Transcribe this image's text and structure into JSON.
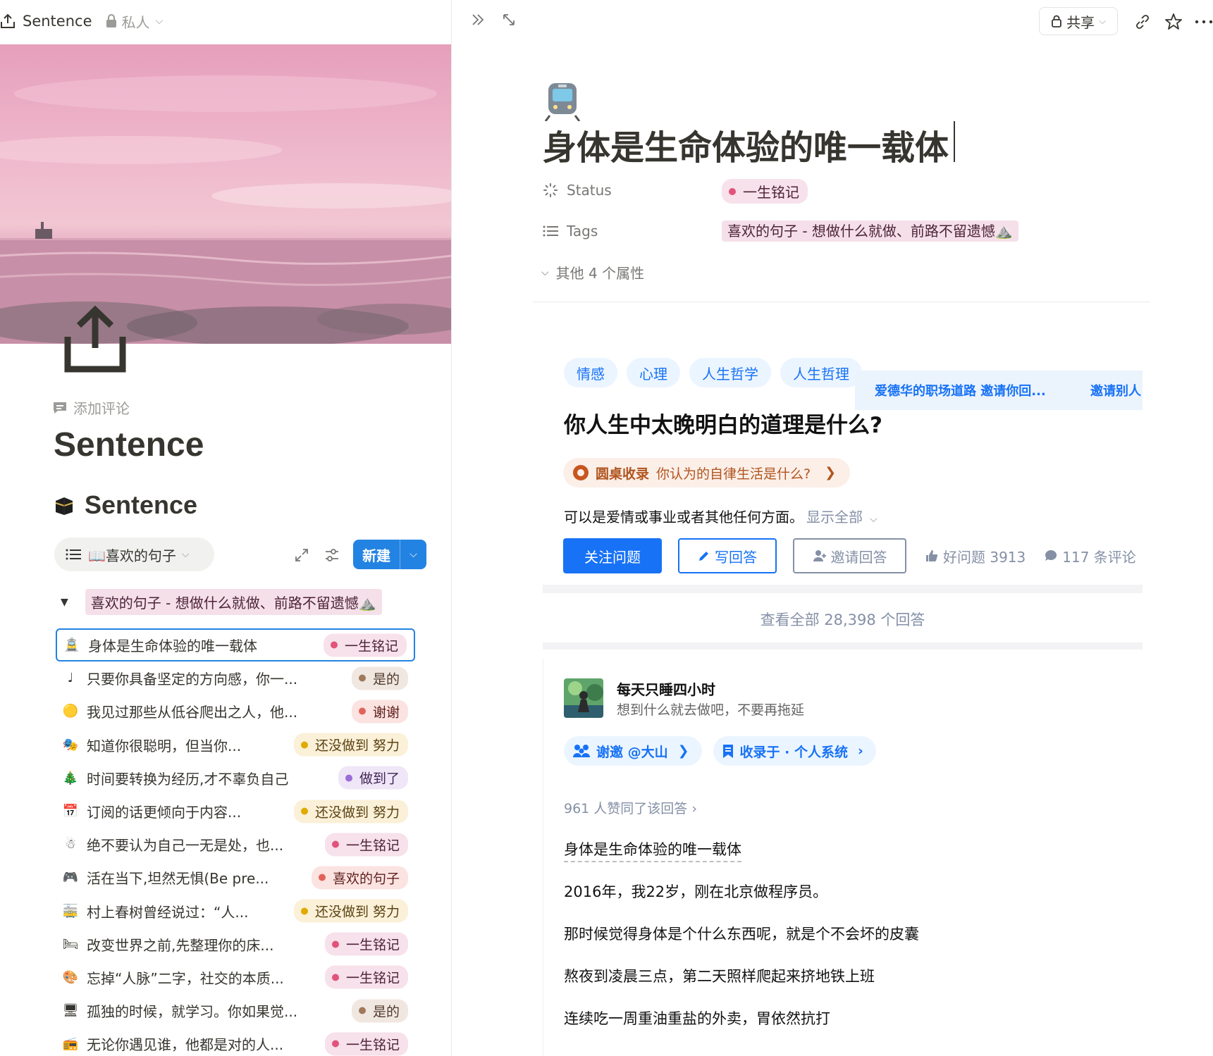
{
  "left": {
    "breadcrumb_title": "Sentence",
    "privacy": "私人",
    "add_comment": "添加评论",
    "page_title": "Sentence",
    "database_title": "Sentence",
    "view_name": "📖喜欢的句子",
    "new_button": "新建",
    "group_label": "喜欢的句子 - 想做什么就做、前路不留遗憾⛰️",
    "rows": [
      {
        "icon": "train-icon",
        "glyph": "🚊",
        "title": "身体是生命体验的唯一载体",
        "status": "一生铭记",
        "bg": "#f7e1ea",
        "fg": "#4c2337",
        "dot": "#e2527a"
      },
      {
        "icon": "music-note-icon",
        "glyph": "♩",
        "title": "只要你具备坚定的方向感，你一...",
        "status": "是的",
        "bg": "#f1e7e1",
        "fg": "#4f3a2c",
        "dot": "#a0785a"
      },
      {
        "icon": "coin-icon",
        "glyph": "🟡",
        "title": "我见过那些从低谷爬出之人，他...",
        "status": "谢谢",
        "bg": "#fbe3e1",
        "fg": "#5e1e1a",
        "dot": "#e16259"
      },
      {
        "icon": "masks-icon",
        "glyph": "🎭",
        "title": "知道你很聪明，但当你...",
        "status": "还没做到 努力",
        "bg": "#fbf0d8",
        "fg": "#5a4312",
        "dot": "#dfab01"
      },
      {
        "icon": "tree-icon",
        "glyph": "🎄",
        "title": "时间要转换为经历,才不辜负自己",
        "status": "做到了",
        "bg": "#efe6f7",
        "fg": "#412454",
        "dot": "#9a6dd7"
      },
      {
        "icon": "calendar-icon",
        "glyph": "📅",
        "title": "订阅的话更倾向于内容...",
        "status": "还没做到 努力",
        "bg": "#fbf0d8",
        "fg": "#5a4312",
        "dot": "#dfab01"
      },
      {
        "icon": "snowman-icon",
        "glyph": "☃",
        "title": "绝不要认为自己一无是处，也...",
        "status": "一生铭记",
        "bg": "#f7e1ea",
        "fg": "#4c2337",
        "dot": "#e2527a"
      },
      {
        "icon": "gamepad-icon",
        "glyph": "🎮",
        "title": "活在当下,坦然无惧(Be pre...",
        "status": "喜欢的句子",
        "bg": "#fbe3e1",
        "fg": "#5e1e1a",
        "dot": "#e16259"
      },
      {
        "icon": "tram-icon",
        "glyph": "🚋",
        "title": "村上春树曾经说过：“人...",
        "status": "还没做到 努力",
        "bg": "#fbf0d8",
        "fg": "#5a4312",
        "dot": "#dfab01"
      },
      {
        "icon": "bed-icon",
        "glyph": "🛏",
        "title": "改变世界之前,先整理你的床...",
        "status": "一生铭记",
        "bg": "#f7e1ea",
        "fg": "#4c2337",
        "dot": "#e2527a"
      },
      {
        "icon": "palette-icon",
        "glyph": "🎨",
        "title": "忘掉“人脉”二字，社交的本质...",
        "status": "一生铭记",
        "bg": "#f7e1ea",
        "fg": "#4c2337",
        "dot": "#e2527a"
      },
      {
        "icon": "monitor-icon",
        "glyph": "🖥",
        "title": "孤独的时候，就学习。你如果觉...",
        "status": "是的",
        "bg": "#f1e7e1",
        "fg": "#4f3a2c",
        "dot": "#a0785a"
      },
      {
        "icon": "radio-icon",
        "glyph": "📻",
        "title": "无论你遇见谁，他都是对的人...",
        "status": "一生铭记",
        "bg": "#f7e1ea",
        "fg": "#4c2337",
        "dot": "#e2527a"
      }
    ]
  },
  "right": {
    "share_label": "共享",
    "page_title": "身体是生命体验的唯一载体",
    "prop_status_label": "Status",
    "prop_status_value": "一生铭记",
    "prop_tags_label": "Tags",
    "prop_tags_value": "喜欢的句子 - 想做什么就做、前路不留遗憾⛰️",
    "more_props": "其他 4 个属性",
    "zhihu": {
      "topics": [
        "情感",
        "心理",
        "人生哲学",
        "人生哲理"
      ],
      "invite_strip_left": "爱德华的职场道路 邀请你回...",
      "invite_strip_right": "邀请别人",
      "question": "你人生中太晚明白的道理是什么?",
      "roundtable_prefix": "圆桌收录",
      "roundtable_text": "你认为的自律生活是什么?",
      "roundtable_arrow": "❯",
      "description": "可以是爱情或事业或者其他任何方面。",
      "show_all": "显示全部",
      "follow": "关注问题",
      "write": "写回答",
      "invite": "邀请回答",
      "good_question": "好问题 3913",
      "comments": "117 条评论",
      "view_all": "查看全部 28,398 个回答",
      "author": "每天只睡四小时",
      "bio": "想到什么就去做吧，不要再拖延",
      "chip_invite": "谢邀 @大山",
      "chip_invite_arrow": "❯",
      "chip_collect": "收录于 · 个人系统",
      "chip_collect_arrow": "›",
      "likes": "961 人赞同了该回答 ›",
      "paragraphs": [
        "身体是生命体验的唯一载体",
        "2016年，我22岁，刚在北京做程序员。",
        "那时候觉得身体是个什么东西呢，就是个不会坏的皮囊",
        "熬夜到凌晨三点，第二天照样爬起来挤地铁上班",
        "连续吃一周重油重盐的外卖，胃依然抗打"
      ]
    }
  }
}
